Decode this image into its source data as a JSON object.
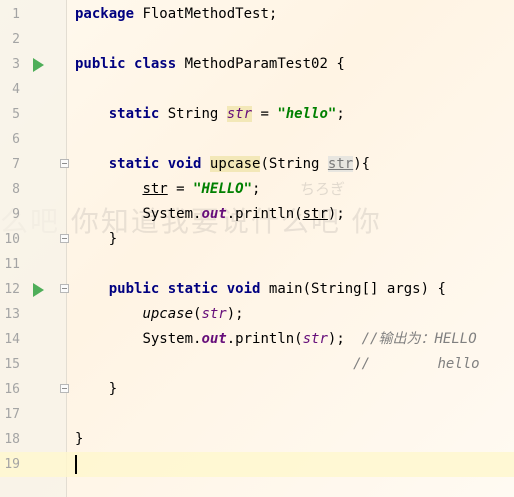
{
  "watermark": {
    "text": "么吧    你知道我要说什么吧        你",
    "signature": "ちろぎ"
  },
  "icons": {
    "run": "run-gutter-icon",
    "fold": "fold-toggle-icon"
  },
  "colors": {
    "keyword": "#000080",
    "string": "#008000",
    "static_field": "#660e7a",
    "comment": "#808080",
    "line_number": "#a4a4a4"
  },
  "lines": [
    {
      "n": "1",
      "t": {
        "kw": "package",
        "rest": " FloatMethodTest;"
      }
    },
    {
      "n": "2"
    },
    {
      "n": "3",
      "t": {
        "kw1": "public",
        "kw2": "class",
        "rest": " MethodParamTest02 {"
      }
    },
    {
      "n": "4"
    },
    {
      "n": "5",
      "t": {
        "kw1": "static",
        "type": " String ",
        "field": "str",
        "eq": " = ",
        "str": "\"hello\"",
        "end": ";"
      }
    },
    {
      "n": "6"
    },
    {
      "n": "7",
      "t": {
        "kw1": "static",
        "kw2": "void",
        "method": "upcase",
        "open": "(String ",
        "param": "str",
        "close": "){"
      }
    },
    {
      "n": "8",
      "t": {
        "var": "str",
        "eq": " = ",
        "str": "\"HELLO\"",
        "end": ";"
      }
    },
    {
      "n": "9",
      "t": {
        "obj": "System.",
        "field": "out",
        "call": ".println(",
        "arg": "str",
        "end": ");"
      }
    },
    {
      "n": "10",
      "t": {
        "brace": "}"
      }
    },
    {
      "n": "11"
    },
    {
      "n": "12",
      "t": {
        "kw1": "public",
        "kw2": "static",
        "kw3": "void",
        "rest": " main(String[] args) {"
      }
    },
    {
      "n": "13",
      "t": {
        "method": "upcase",
        "open": "(",
        "arg": "str",
        "end": ");"
      }
    },
    {
      "n": "14",
      "t": {
        "obj": "System.",
        "field": "out",
        "call": ".println(",
        "arg": "str",
        "end": ");",
        "comment": "//输出为：HELLO"
      }
    },
    {
      "n": "15",
      "t": {
        "comment": "//        hello"
      }
    },
    {
      "n": "16",
      "t": {
        "brace": "}"
      }
    },
    {
      "n": "17"
    },
    {
      "n": "18",
      "t": {
        "brace": "}"
      }
    },
    {
      "n": "19"
    }
  ]
}
